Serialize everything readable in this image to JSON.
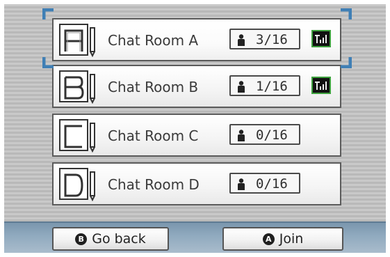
{
  "rooms": [
    {
      "icon_letter": "A",
      "name": "Chat Room A",
      "count": "3/16",
      "signal": true,
      "selected": true
    },
    {
      "icon_letter": "B",
      "name": "Chat Room B",
      "count": "1/16",
      "signal": true,
      "selected": false
    },
    {
      "icon_letter": "C",
      "name": "Chat Room C",
      "count": "0/16",
      "signal": false,
      "selected": false
    },
    {
      "icon_letter": "D",
      "name": "Chat Room D",
      "count": "0/16",
      "signal": false,
      "selected": false
    }
  ],
  "buttons": {
    "back": {
      "icon": "B",
      "label": "Go back"
    },
    "join": {
      "icon": "A",
      "label": "Join"
    }
  },
  "colors": {
    "signal_border": "#3ea13e",
    "selection_corner": "#3f7fb5",
    "bottom_bar": "#8fa9be"
  },
  "icons": {
    "person": "person-icon",
    "signal": "signal-strength-icon",
    "selection": "selection-corner-icon"
  }
}
